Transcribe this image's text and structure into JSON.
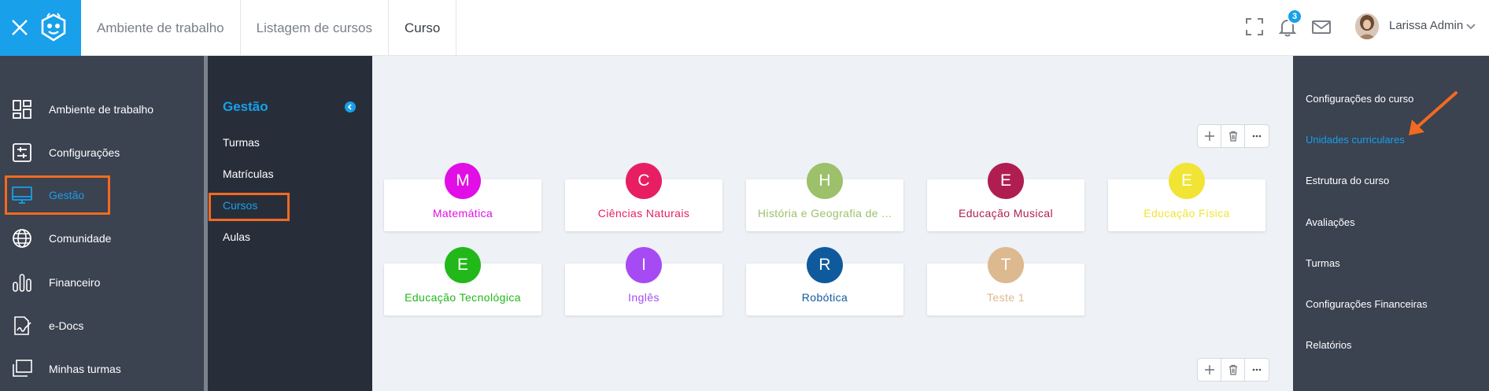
{
  "topbar": {
    "breadcrumbs": [
      "Ambiente de trabalho",
      "Listagem de cursos",
      "Curso"
    ],
    "notifications_count": "3",
    "user_name": "Larissa Admin",
    "brand_color": "#18a0ea"
  },
  "sidebar": {
    "items": [
      {
        "label": "Ambiente de trabalho",
        "icon": "dashboard-icon"
      },
      {
        "label": "Configurações",
        "icon": "settings-sliders-icon"
      },
      {
        "label": "Gestão",
        "icon": "monitor-icon",
        "active": true
      },
      {
        "label": "Comunidade",
        "icon": "globe-icon"
      },
      {
        "label": "Financeiro",
        "icon": "bar-chart-icon"
      },
      {
        "label": "e-Docs",
        "icon": "document-signature-icon"
      },
      {
        "label": "Minhas turmas",
        "icon": "classes-icon"
      }
    ]
  },
  "submenu": {
    "title": "Gestão",
    "items": [
      "Turmas",
      "Matrículas",
      "Cursos",
      "Aulas"
    ],
    "active": "Cursos"
  },
  "courses": [
    {
      "initial": "M",
      "name": "Matemática",
      "color": "#e10ee6"
    },
    {
      "initial": "C",
      "name": "Ciências Naturais",
      "color": "#e81e63"
    },
    {
      "initial": "H",
      "name": "História e Geografia de ...",
      "color": "#9dc06b"
    },
    {
      "initial": "E",
      "name": "Educação Musical",
      "color": "#b01e51"
    },
    {
      "initial": "E",
      "name": "Educação Física",
      "color": "#f2e434"
    },
    {
      "initial": "E",
      "name": "Educação Tecnológica",
      "color": "#22b81a"
    },
    {
      "initial": "I",
      "name": "Inglês",
      "color": "#a64bf4"
    },
    {
      "initial": "R",
      "name": "Robótica",
      "color": "#0f5a9c"
    },
    {
      "initial": "T",
      "name": "Teste 1",
      "color": "#dcb98e"
    }
  ],
  "right_menu": {
    "items": [
      "Configurações do curso",
      "Unidades curriculares",
      "Estrutura do curso",
      "Avaliações",
      "Turmas",
      "Configurações Financeiras",
      "Relatórios"
    ],
    "active": "Unidades curriculares"
  },
  "annotation_color": "#f26a21"
}
